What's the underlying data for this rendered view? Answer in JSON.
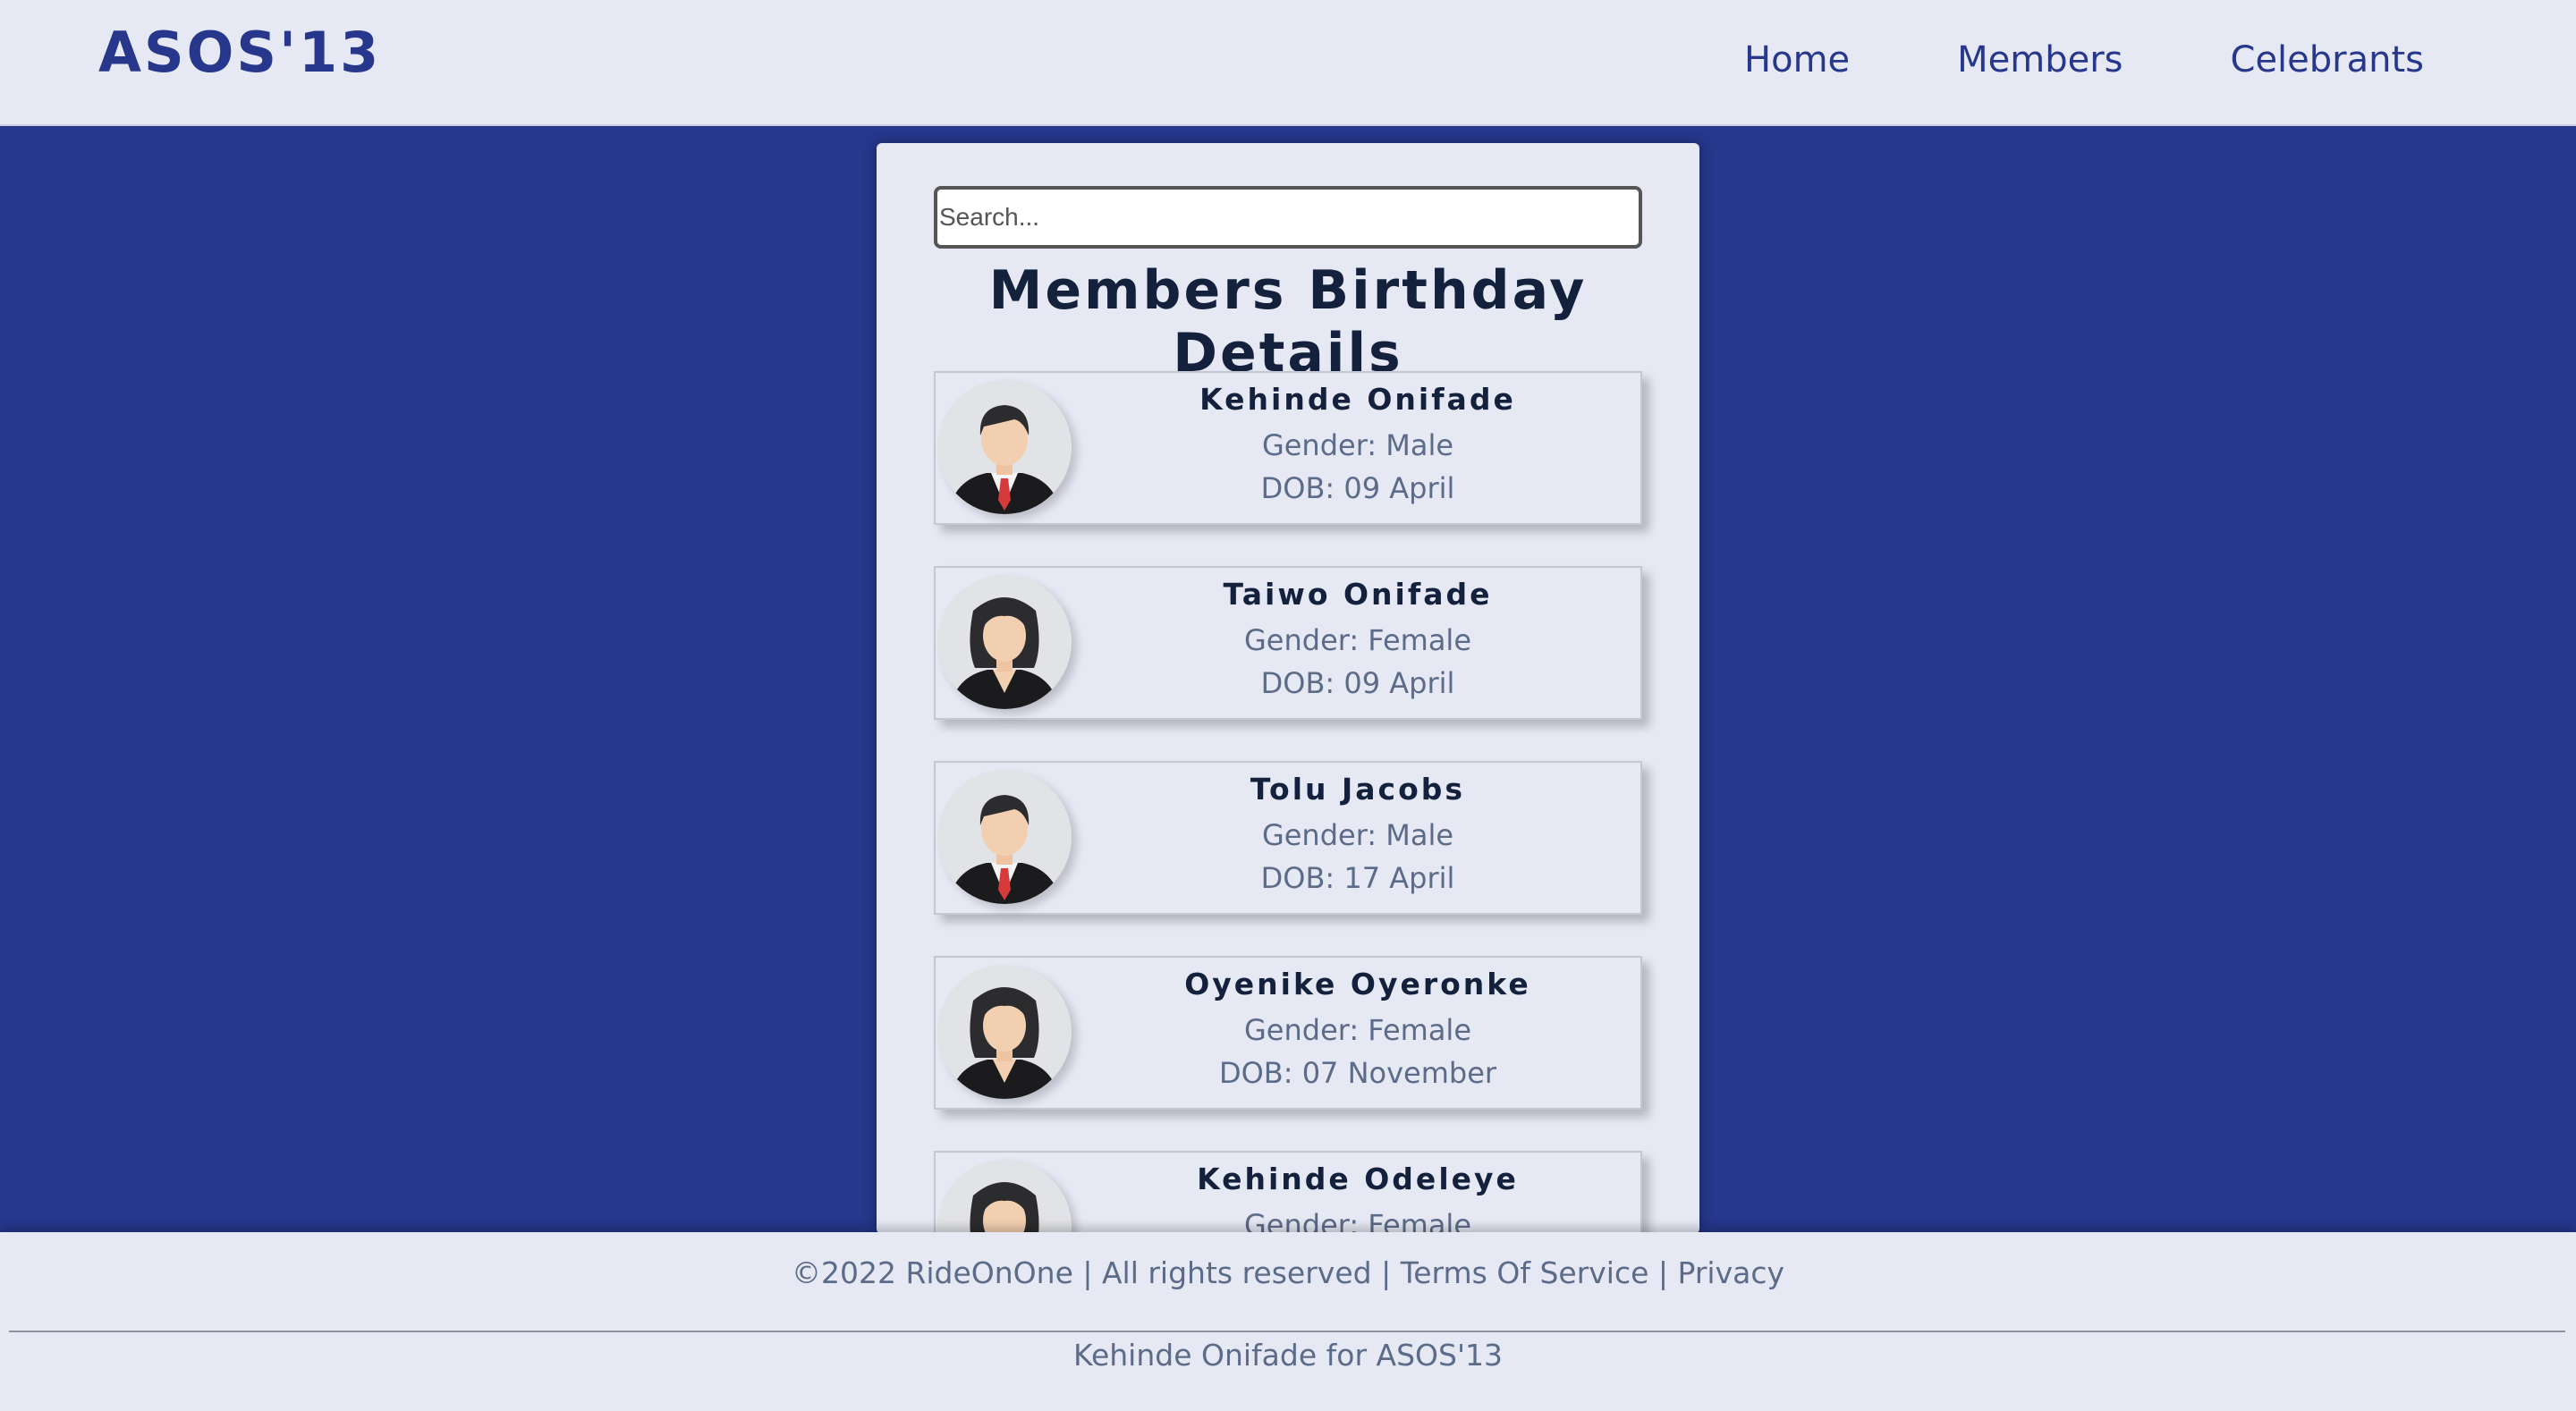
{
  "header": {
    "brand": "ASOS'13",
    "nav": [
      {
        "label": "Home"
      },
      {
        "label": "Members"
      },
      {
        "label": "Celebrants"
      }
    ]
  },
  "search": {
    "placeholder": "Search...",
    "value": ""
  },
  "panel": {
    "title": "Members Birthday Details"
  },
  "members": [
    {
      "name": "Kehinde Onifade",
      "gender": "Gender: Male",
      "dob": "DOB: 09 April",
      "avatar": "male-avatar-icon"
    },
    {
      "name": "Taiwo Onifade",
      "gender": "Gender: Female",
      "dob": "DOB: 09 April",
      "avatar": "female-avatar-icon"
    },
    {
      "name": "Tolu Jacobs",
      "gender": "Gender: Male",
      "dob": "DOB: 17 April",
      "avatar": "male-avatar-icon"
    },
    {
      "name": "Oyenike Oyeronke",
      "gender": "Gender: Female",
      "dob": "DOB: 07 November",
      "avatar": "female-avatar-icon"
    },
    {
      "name": "Kehinde Odeleye",
      "gender": "Gender: Female",
      "dob": "",
      "avatar": "female-avatar-icon"
    }
  ],
  "footer": {
    "copyright": "©2022 RideOnOne | All rights reserved |",
    "terms": "Terms Of Service",
    "separator": "|",
    "privacy": "Privacy",
    "credit": "Kehinde Onifade for ASOS'13"
  },
  "colors": {
    "brand": "#26378c",
    "background": "#26378c",
    "surface": "#e6e9f4",
    "heading": "#14213d",
    "muted": "#5c6b88"
  }
}
